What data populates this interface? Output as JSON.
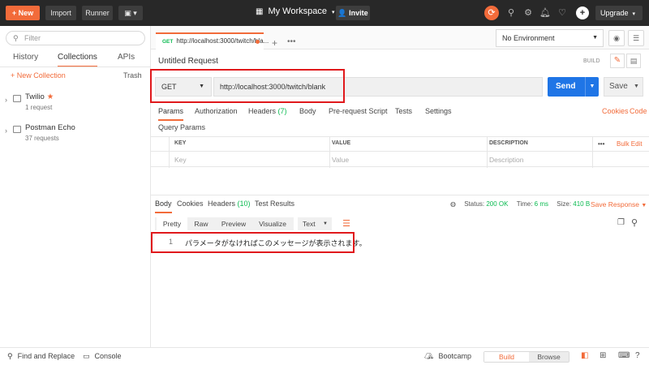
{
  "topbar": {
    "new_label": "New",
    "import_label": "Import",
    "runner_label": "Runner",
    "workspace": "My Workspace",
    "invite_label": "Invite",
    "upgrade_label": "Upgrade"
  },
  "sidebar": {
    "filter_placeholder": "Filter",
    "tabs": [
      "History",
      "Collections",
      "APIs"
    ],
    "new_collection": "New Collection",
    "trash": "Trash",
    "collections": [
      {
        "name": "Twilio",
        "sub": "1 request",
        "starred": true
      },
      {
        "name": "Postman Echo",
        "sub": "37 requests",
        "starred": false
      }
    ]
  },
  "tabstrip": {
    "method": "GET",
    "tab_title": "http://localhost:3000/twitch/bla...",
    "environment": "No Environment"
  },
  "request": {
    "title": "Untitled Request",
    "build": "BUILD",
    "method": "GET",
    "url": "http://localhost:3000/twitch/blank",
    "send": "Send",
    "save": "Save",
    "tabs": {
      "params": "Params",
      "authorization": "Authorization",
      "headers": "Headers",
      "headers_count": "(7)",
      "body": "Body",
      "prerequest": "Pre-request Script",
      "tests": "Tests",
      "settings": "Settings"
    },
    "cookies": "Cookies",
    "code": "Code",
    "query_params_title": "Query Params",
    "table": {
      "headers": [
        "KEY",
        "VALUE",
        "DESCRIPTION"
      ],
      "placeholders": [
        "Key",
        "Value",
        "Description"
      ],
      "bulk_edit": "Bulk Edit",
      "more": "•••"
    }
  },
  "response": {
    "tabs": {
      "body": "Body",
      "cookies": "Cookies",
      "headers": "Headers",
      "headers_count": "(10)",
      "test_results": "Test Results"
    },
    "status_label": "Status:",
    "status_value": "200 OK",
    "time_label": "Time:",
    "time_value": "6 ms",
    "size_label": "Size:",
    "size_value": "410 B",
    "save_response": "Save Response",
    "formats": [
      "Pretty",
      "Raw",
      "Preview",
      "Visualize"
    ],
    "type": "Text",
    "line_number": "1",
    "body_text": "パラメータがなければこのメッセージが表示されます。"
  },
  "footer": {
    "find_replace": "Find and Replace",
    "console": "Console",
    "bootcamp": "Bootcamp",
    "build": "Build",
    "browse": "Browse"
  },
  "colors": {
    "accent": "#f26b3a",
    "send_blue": "#1f75e6",
    "status_green": "#0cbb52",
    "highlight_red": "#e0191c"
  }
}
